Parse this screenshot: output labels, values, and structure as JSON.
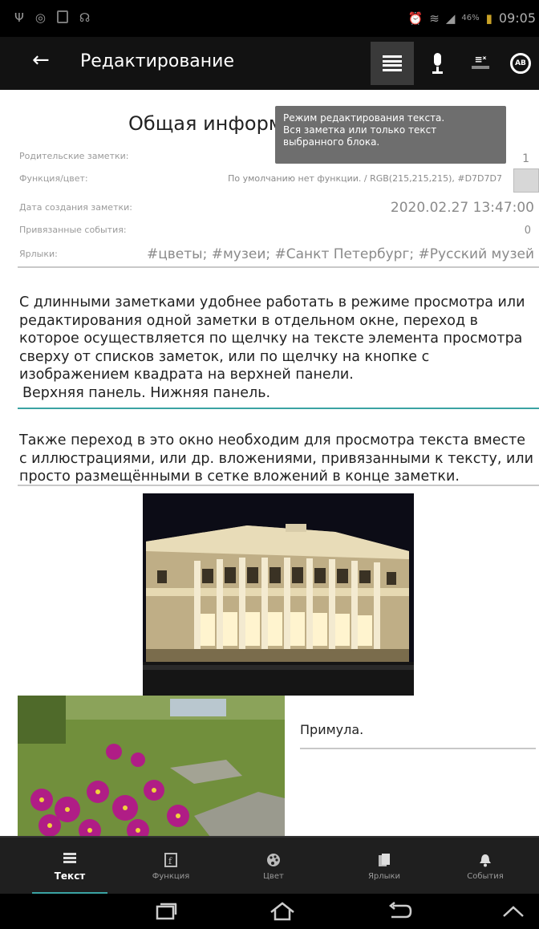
{
  "status_bar": {
    "time": "09:05",
    "battery": "46%"
  },
  "toolbar": {
    "back_icon": "arrow-left-icon",
    "title": "Редактирование",
    "buttons": [
      "text-mode-icon",
      "microphone-icon",
      "clear-format-icon",
      "ab-toggle-icon"
    ]
  },
  "tooltip": {
    "line1": "Режим редактирования текста.",
    "line2": "Вся заметка или только текст",
    "line3": "выбранного блока."
  },
  "info": {
    "title": "Общая информация",
    "rows": [
      {
        "label": "Родительские заметки:",
        "value": "1"
      },
      {
        "label": "Функция/цвет:",
        "value": "По умолчанию нет функции. / RGB(215,215,215), #D7D7D7"
      },
      {
        "label": "Дата создания заметки:",
        "value": "2020.02.27 13:47:00"
      },
      {
        "label": "Привязанные события:",
        "value": "0"
      },
      {
        "label": "Ярлыки:",
        "value": "#цветы; #музеи; #Санкт Петербург; #Русский музей"
      }
    ],
    "swatch_color": "#D7D7D7"
  },
  "paragraphs": {
    "p1": "С длинными заметками удобнее работать в режиме просмотра или редактирования одной заметки в отдельном окне, переход в которое осуществляется по щелчку на тексте элемента просмотра сверху от списков заметок, или по щелчку на кнопке с изображением квадрата на верхней панели.",
    "p1_sub": "Верхняя панель. Нижняя панель.",
    "p2": "Также переход в это окно необходим для просмотра текста вместе с иллюстрациями, или др. вложениями, привязанными к тексту, или просто размещёнными в сетке вложений в конце заметки."
  },
  "attachments": {
    "museum_image": "museum-photo",
    "flowers_image": "flowers-photo",
    "caption": "Примула."
  },
  "bottom_tabs": [
    {
      "label": "Текст",
      "icon": "text-icon",
      "active": true
    },
    {
      "label": "Функция",
      "icon": "function-icon",
      "active": false
    },
    {
      "label": "Цвет",
      "icon": "palette-icon",
      "active": false
    },
    {
      "label": "Ярлыки",
      "icon": "tags-icon",
      "active": false
    },
    {
      "label": "События",
      "icon": "bell-icon",
      "active": false
    }
  ],
  "colors": {
    "accent": "#3AA3A3",
    "toolbar": "#121212"
  }
}
